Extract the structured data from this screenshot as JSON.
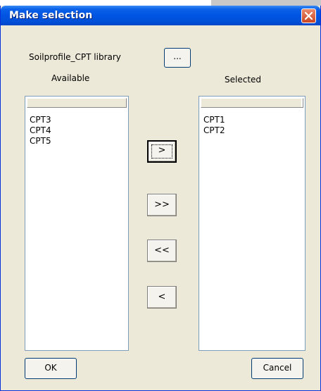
{
  "window": {
    "title": "Make selection"
  },
  "library": {
    "label": "Soilprofile_CPT library",
    "browse_label": "..."
  },
  "available": {
    "label": "Available",
    "items": [
      "CPT3",
      "CPT4",
      "CPT5"
    ]
  },
  "selected": {
    "label": "Selected",
    "items": [
      "CPT1",
      "CPT2"
    ]
  },
  "transfer": {
    "add_label": ">",
    "add_all_label": ">>",
    "remove_all_label": "<<",
    "remove_label": "<"
  },
  "buttons": {
    "ok_label": "OK",
    "cancel_label": "Cancel"
  }
}
